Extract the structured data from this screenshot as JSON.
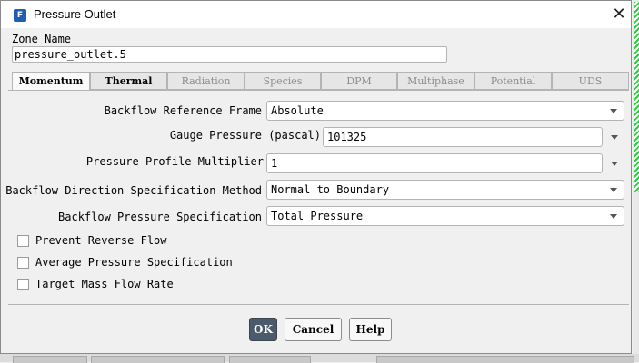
{
  "window": {
    "title": "Pressure Outlet",
    "app_icon_letter": "F"
  },
  "zone": {
    "label": "Zone Name",
    "value": "pressure_outlet.5"
  },
  "tabs": [
    {
      "label": "Momentum",
      "state": "active"
    },
    {
      "label": "Thermal",
      "state": "enabled"
    },
    {
      "label": "Radiation",
      "state": "disabled"
    },
    {
      "label": "Species",
      "state": "disabled"
    },
    {
      "label": "DPM",
      "state": "disabled"
    },
    {
      "label": "Multiphase",
      "state": "disabled"
    },
    {
      "label": "Potential",
      "state": "disabled"
    },
    {
      "label": "UDS",
      "state": "disabled"
    }
  ],
  "momentum": {
    "backflow_reference_frame": {
      "label": "Backflow Reference Frame",
      "value": "Absolute"
    },
    "gauge_pressure": {
      "label": "Gauge Pressure (pascal)",
      "value": "101325"
    },
    "pressure_profile_multiplier": {
      "label": "Pressure Profile Multiplier",
      "value": "1"
    },
    "backflow_direction_method": {
      "label": "Backflow Direction Specification Method",
      "value": "Normal to Boundary"
    },
    "backflow_pressure_spec": {
      "label": "Backflow Pressure Specification",
      "value": "Total Pressure"
    },
    "checkboxes": [
      {
        "label": "Prevent Reverse Flow",
        "checked": false
      },
      {
        "label": "Average Pressure Specification",
        "checked": false
      },
      {
        "label": "Target Mass Flow Rate",
        "checked": false
      }
    ]
  },
  "buttons": {
    "ok": "OK",
    "cancel": "Cancel",
    "help": "Help"
  },
  "colors": {
    "primary_button": "#4c5b6b",
    "app_icon": "#1e5fb4",
    "background_stripe": "#2ecc40"
  }
}
